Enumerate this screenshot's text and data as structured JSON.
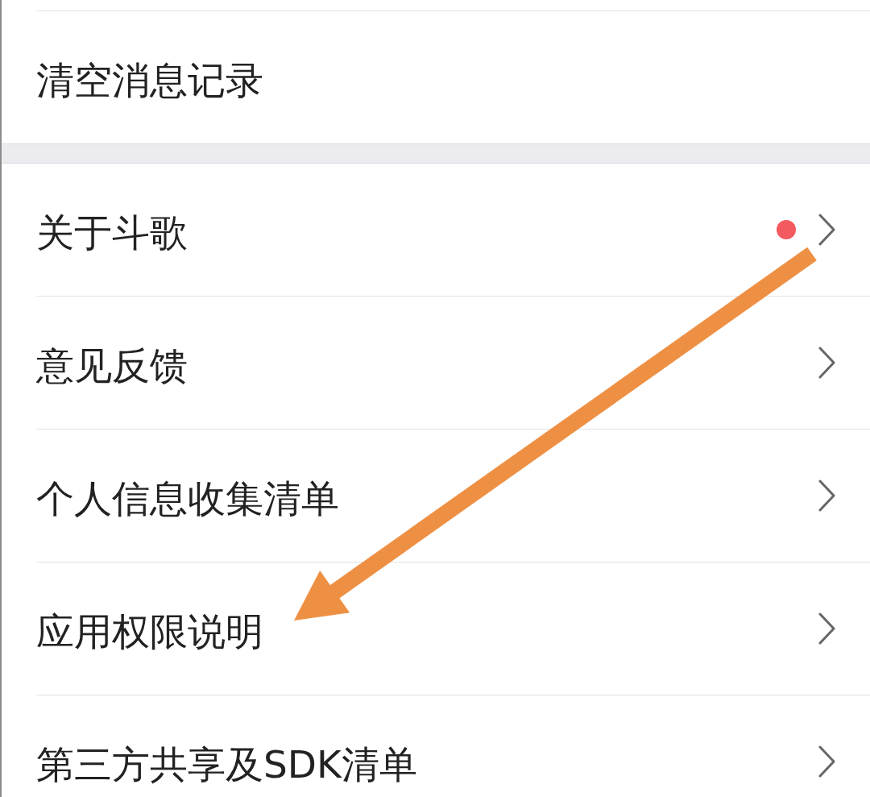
{
  "sections": [
    {
      "items": [
        {
          "kind": "action",
          "label": "清空消息记录"
        }
      ]
    },
    {
      "items": [
        {
          "kind": "link",
          "label": "关于斗歌",
          "dot": true
        },
        {
          "kind": "link",
          "label": "意见反馈",
          "dot": false
        },
        {
          "kind": "link",
          "label": "个人信息收集清单",
          "dot": false
        },
        {
          "kind": "link",
          "label": "应用权限说明",
          "dot": false
        },
        {
          "kind": "link",
          "label": "第三方共享及SDK清单",
          "dot": false
        }
      ]
    }
  ],
  "annotations": [
    {
      "kind": "arrow"
    }
  ]
}
